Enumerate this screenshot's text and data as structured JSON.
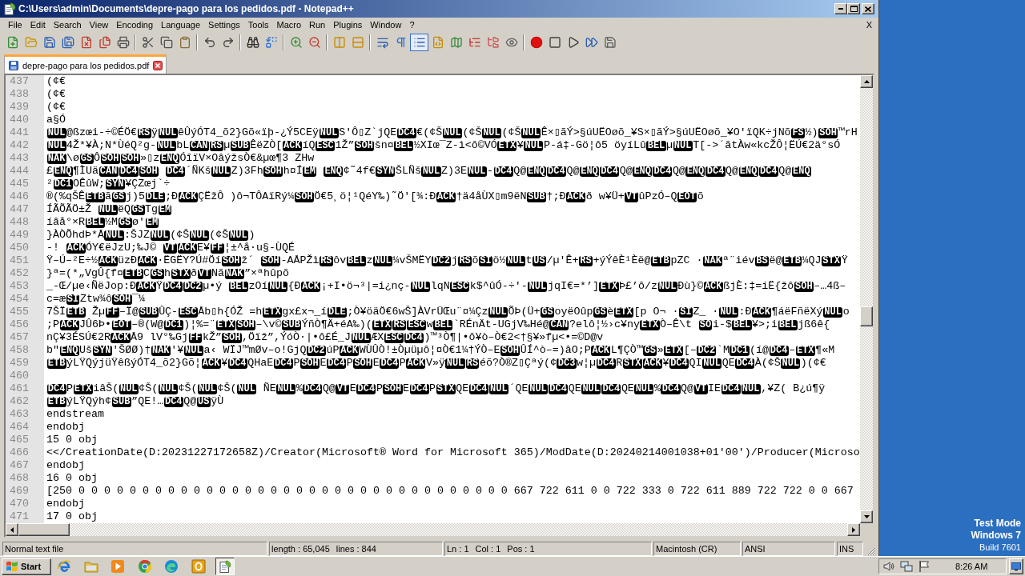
{
  "window": {
    "title": "C:\\Users\\admin\\Documents\\depre-pago para los pedidos.pdf - Notepad++"
  },
  "menu": {
    "items": [
      "File",
      "Edit",
      "Search",
      "View",
      "Encoding",
      "Language",
      "Settings",
      "Tools",
      "Macro",
      "Run",
      "Plugins",
      "Window",
      "?"
    ],
    "close_label": "X"
  },
  "toolbar": {
    "buttons": [
      {
        "pressed": false
      },
      {
        "pressed": false
      },
      {
        "pressed": false
      },
      {
        "pressed": false
      },
      {
        "pressed": false
      },
      {
        "pressed": false
      },
      {
        "pressed": false
      },
      {
        "pressed": false
      },
      {
        "pressed": false
      },
      {
        "pressed": false
      },
      {
        "pressed": false
      },
      {
        "pressed": false
      },
      {
        "pressed": false
      },
      {
        "pressed": false
      },
      {
        "pressed": false
      },
      {
        "pressed": false
      },
      {
        "pressed": false
      },
      {
        "pressed": false
      },
      {
        "pressed": false
      },
      {
        "pressed": false
      },
      {
        "pressed": true
      },
      {
        "pressed": false
      },
      {
        "pressed": false
      },
      {
        "pressed": false
      },
      {
        "pressed": false
      },
      {
        "pressed": false
      },
      {
        "pressed": false
      },
      {
        "pressed": false
      },
      {
        "pressed": false
      },
      {
        "pressed": false
      },
      {
        "pressed": false
      }
    ]
  },
  "tabs": [
    {
      "label": "depre-pago para los pedidos.pdf",
      "selected": true
    }
  ],
  "editor": {
    "lines": [
      {
        "number": "437",
        "segments": [
          {
            "kind": "text",
            "text": "(¢€"
          }
        ]
      },
      {
        "number": "438",
        "segments": [
          {
            "kind": "text",
            "text": "(¢€"
          }
        ]
      },
      {
        "number": "439",
        "segments": [
          {
            "kind": "text",
            "text": "(¢€"
          }
        ]
      },
      {
        "number": "440",
        "segments": [
          {
            "kind": "text",
            "text": "a§Ó"
          }
        ]
      },
      {
        "number": "441",
        "segments": [
          {
            "kind": "ctrl",
            "text": "NUL"
          },
          {
            "kind": "text",
            "text": "@ßzœi-÷©ÉÖ€"
          },
          {
            "kind": "ctrl",
            "text": "RS"
          },
          {
            "kind": "text",
            "text": "ÿ"
          },
          {
            "kind": "ctrl",
            "text": "NUL"
          },
          {
            "kind": "text",
            "text": "êÛýÓT4_õ2}Gõ«ïþ-¿Ý5CEÿ"
          },
          {
            "kind": "ctrl",
            "text": "NUL"
          },
          {
            "kind": "text",
            "text": "S'Ô▯Z`jQE"
          },
          {
            "kind": "ctrl",
            "text": "DC4"
          },
          {
            "kind": "text",
            "text": "€(¢Š"
          },
          {
            "kind": "ctrl",
            "text": "NUL"
          },
          {
            "kind": "text",
            "text": "(¢Š"
          },
          {
            "kind": "ctrl",
            "text": "NUL"
          },
          {
            "kind": "text",
            "text": "(¢Š"
          },
          {
            "kind": "ctrl",
            "text": "NUL"
          },
          {
            "kind": "text",
            "text": "Ê×▯ãÝ>§úUËOøõ_¥S×▯ãÝ>§úUËOøõ_¥O'ïQK÷jNõ"
          },
          {
            "kind": "ctrl",
            "text": "FS"
          },
          {
            "kind": "text",
            "text": "½)"
          },
          {
            "kind": "ctrl",
            "text": "SOH"
          },
          {
            "kind": "text",
            "text": "™rH"
          }
        ]
      },
      {
        "number": "442",
        "segments": [
          {
            "kind": "ctrl",
            "text": "NUL"
          },
          {
            "kind": "text",
            "text": "4Ž*¥À;N*ÙéQ²g-"
          },
          {
            "kind": "ctrl",
            "text": "NUL"
          },
          {
            "kind": "text",
            "text": "bL"
          },
          {
            "kind": "ctrl",
            "text": "CAN"
          },
          {
            "kind": "ctrl",
            "text": "RS"
          },
          {
            "kind": "text",
            "text": "µ"
          },
          {
            "kind": "ctrl",
            "text": "SUB"
          },
          {
            "kind": "text",
            "text": "ÊëZÒ["
          },
          {
            "kind": "ctrl",
            "text": "ACK"
          },
          {
            "kind": "text",
            "text": "íQ"
          },
          {
            "kind": "ctrl",
            "text": "ESC"
          },
          {
            "kind": "text",
            "text": "1Ž”"
          },
          {
            "kind": "ctrl",
            "text": "SOH"
          },
          {
            "kind": "text",
            "text": "šn¤"
          },
          {
            "kind": "ctrl",
            "text": "BEL"
          },
          {
            "kind": "text",
            "text": "½XIœ¯Z-ì<ô©VÓ"
          },
          {
            "kind": "ctrl",
            "text": "ETX"
          },
          {
            "kind": "text",
            "text": "¥"
          },
          {
            "kind": "ctrl",
            "text": "NUL"
          },
          {
            "kind": "text",
            "text": "P-á‡-Gö¦ô5 öyíLû"
          },
          {
            "kind": "ctrl",
            "text": "BEL"
          },
          {
            "kind": "text",
            "text": "µ"
          },
          {
            "kind": "ctrl",
            "text": "NUL"
          },
          {
            "kind": "text",
            "text": "T[->´ãtÀw«kcŽÔ¦ËÚ€2ä°sÓ"
          }
        ]
      },
      {
        "number": "443",
        "segments": [
          {
            "kind": "ctrl",
            "text": "NAK"
          },
          {
            "kind": "text",
            "text": "\\ø"
          },
          {
            "kind": "ctrl",
            "text": "GS"
          },
          {
            "kind": "text",
            "text": "Ô"
          },
          {
            "kind": "ctrl",
            "text": "SOH"
          },
          {
            "kind": "ctrl",
            "text": "SOH"
          },
          {
            "kind": "text",
            "text": "»▯z"
          },
          {
            "kind": "ctrl",
            "text": "ENQ"
          },
          {
            "kind": "text",
            "text": "ÓîïV×OâýžsÒ€&µœ¶3 ZHw"
          }
        ]
      },
      {
        "number": "444",
        "segments": [
          {
            "kind": "text",
            "text": "£"
          },
          {
            "kind": "ctrl",
            "text": "ENQ"
          },
          {
            "kind": "text",
            "text": "¶ÌUä"
          },
          {
            "kind": "ctrl",
            "text": "CAN"
          },
          {
            "kind": "ctrl",
            "text": "DC4"
          },
          {
            "kind": "ctrl",
            "text": "SOH"
          },
          {
            "kind": "space"
          },
          {
            "kind": "ctrl",
            "text": "DC4"
          },
          {
            "kind": "text",
            "text": "´ÑKš"
          },
          {
            "kind": "ctrl",
            "text": "NUL"
          },
          {
            "kind": "text",
            "text": "Z)3Fh"
          },
          {
            "kind": "ctrl",
            "text": "SOH"
          },
          {
            "kind": "text",
            "text": "h¤Í"
          },
          {
            "kind": "ctrl",
            "text": "EM"
          },
          {
            "kind": "space"
          },
          {
            "kind": "ctrl",
            "text": "ENQ"
          },
          {
            "kind": "text",
            "text": "¢˜4f€"
          },
          {
            "kind": "ctrl",
            "text": "SYN"
          },
          {
            "kind": "text",
            "text": "ŠLÑš"
          },
          {
            "kind": "ctrl",
            "text": "NUL"
          },
          {
            "kind": "text",
            "text": "Z)3E"
          },
          {
            "kind": "ctrl",
            "text": "NUL"
          },
          {
            "kind": "text",
            "text": "-"
          },
          {
            "kind": "ctrl",
            "text": "DC4"
          },
          {
            "kind": "text",
            "text": "Q@"
          },
          {
            "kind": "ctrl",
            "text": "ENQ"
          },
          {
            "kind": "ctrl",
            "text": "DC4"
          },
          {
            "kind": "text",
            "text": "Q@"
          },
          {
            "kind": "ctrl",
            "text": "ENQ"
          },
          {
            "kind": "ctrl",
            "text": "DC4"
          },
          {
            "kind": "text",
            "text": "Q@"
          },
          {
            "kind": "ctrl",
            "text": "ENQ"
          },
          {
            "kind": "ctrl",
            "text": "DC4"
          },
          {
            "kind": "text",
            "text": "Q@"
          },
          {
            "kind": "ctrl",
            "text": "ENQ"
          },
          {
            "kind": "ctrl",
            "text": "DC4"
          },
          {
            "kind": "text",
            "text": "Q@"
          },
          {
            "kind": "ctrl",
            "text": "ENQ"
          },
          {
            "kind": "ctrl",
            "text": "DC4"
          },
          {
            "kind": "text",
            "text": "Q@"
          },
          {
            "kind": "ctrl",
            "text": "ENQ"
          }
        ]
      },
      {
        "number": "445",
        "segments": [
          {
            "kind": "text",
            "text": "²"
          },
          {
            "kind": "ctrl",
            "text": "DC1"
          },
          {
            "kind": "text",
            "text": "OÊûW;"
          },
          {
            "kind": "ctrl",
            "text": "SYN"
          },
          {
            "kind": "text",
            "text": "¥ÇZœj`÷"
          }
        ]
      },
      {
        "number": "446",
        "segments": [
          {
            "kind": "text",
            "text": "®(%qŠÊ"
          },
          {
            "kind": "ctrl",
            "text": "ETB"
          },
          {
            "kind": "text",
            "text": "ã"
          },
          {
            "kind": "ctrl",
            "text": "GS"
          },
          {
            "kind": "text",
            "text": "j)5"
          },
          {
            "kind": "ctrl",
            "text": "DLE"
          },
          {
            "kind": "text",
            "text": ";Ð"
          },
          {
            "kind": "ctrl",
            "text": "ACK"
          },
          {
            "kind": "text",
            "text": "ÇËžÔ )ô¬TÔAïRý¼"
          },
          {
            "kind": "ctrl",
            "text": "SOH"
          },
          {
            "kind": "text",
            "text": "Ö€5¸ö¦¹QéY‰)˜Ö'[¾:Ð"
          },
          {
            "kind": "ctrl",
            "text": "ACK"
          },
          {
            "kind": "text",
            "text": "†ä4åÙX▯m9ëN"
          },
          {
            "kind": "ctrl",
            "text": "SUB"
          },
          {
            "kind": "text",
            "text": "†;Ð"
          },
          {
            "kind": "ctrl",
            "text": "ACK"
          },
          {
            "kind": "text",
            "text": "ð w¥Ü+"
          },
          {
            "kind": "ctrl",
            "text": "VT"
          },
          {
            "kind": "text",
            "text": "ûPzÓ–Q"
          },
          {
            "kind": "ctrl",
            "text": "EOT"
          },
          {
            "kind": "text",
            "text": "õ"
          }
        ]
      },
      {
        "number": "447",
        "segments": [
          {
            "kind": "text",
            "text": "ÍÃÕÃÖ±Ž "
          },
          {
            "kind": "ctrl",
            "text": "NUL"
          },
          {
            "kind": "text",
            "text": "ëQ"
          },
          {
            "kind": "ctrl",
            "text": "GS"
          },
          {
            "kind": "text",
            "text": "Tg"
          },
          {
            "kind": "ctrl",
            "text": "EM"
          }
        ]
      },
      {
        "number": "448",
        "segments": [
          {
            "kind": "text",
            "text": "íâå°×R"
          },
          {
            "kind": "ctrl",
            "text": "BEL"
          },
          {
            "kind": "text",
            "text": "½M"
          },
          {
            "kind": "ctrl",
            "text": "GS"
          },
          {
            "kind": "text",
            "text": "ø'"
          },
          {
            "kind": "ctrl",
            "text": "EM"
          }
        ]
      },
      {
        "number": "449",
        "segments": [
          {
            "kind": "text",
            "text": "}ÀÒÕhdÞ*Å"
          },
          {
            "kind": "ctrl",
            "text": "NUL"
          },
          {
            "kind": "text",
            "text": ":ŠJZ"
          },
          {
            "kind": "ctrl",
            "text": "NUL"
          },
          {
            "kind": "text",
            "text": "(¢Š"
          },
          {
            "kind": "ctrl",
            "text": "NUL"
          },
          {
            "kind": "text",
            "text": "(¢Š"
          },
          {
            "kind": "ctrl",
            "text": "NUL"
          },
          {
            "kind": "text",
            "text": ")"
          }
        ]
      },
      {
        "number": "450",
        "segments": [
          {
            "kind": "text",
            "text": "-! "
          },
          {
            "kind": "ctrl",
            "text": "ACK"
          },
          {
            "kind": "text",
            "text": "ÓY€ëJzU;‰J© "
          },
          {
            "kind": "ctrl",
            "text": "VT"
          },
          {
            "kind": "ctrl",
            "text": "ACK"
          },
          {
            "kind": "text",
            "text": "E¥"
          },
          {
            "kind": "ctrl",
            "text": "FF"
          },
          {
            "kind": "text",
            "text": "¦±^å·u§-ÙQÉ"
          }
        ]
      },
      {
        "number": "451",
        "segments": [
          {
            "kind": "text",
            "text": "Ÿ–Ú–²E÷½"
          },
          {
            "kind": "ctrl",
            "text": "ACK"
          },
          {
            "kind": "text",
            "text": "üzÐ"
          },
          {
            "kind": "ctrl",
            "text": "ACK"
          },
          {
            "kind": "text",
            "text": "·ËGËY?Ú#Öí"
          },
          {
            "kind": "ctrl",
            "text": "SOH"
          },
          {
            "kind": "text",
            "text": "ž´ "
          },
          {
            "kind": "ctrl",
            "text": "SOH"
          },
          {
            "kind": "text",
            "text": "-AÅPŽì"
          },
          {
            "kind": "ctrl",
            "text": "RS"
          },
          {
            "kind": "text",
            "text": "ôv"
          },
          {
            "kind": "ctrl",
            "text": "BEL"
          },
          {
            "kind": "text",
            "text": "z"
          },
          {
            "kind": "ctrl",
            "text": "NUL"
          },
          {
            "kind": "text",
            "text": "¼vŠMËY"
          },
          {
            "kind": "ctrl",
            "text": "DC2"
          },
          {
            "kind": "text",
            "text": "j"
          },
          {
            "kind": "ctrl",
            "text": "RS"
          },
          {
            "kind": "text",
            "text": "õ"
          },
          {
            "kind": "ctrl",
            "text": "SI"
          },
          {
            "kind": "text",
            "text": "ö½"
          },
          {
            "kind": "ctrl",
            "text": "NUL"
          },
          {
            "kind": "text",
            "text": "t"
          },
          {
            "kind": "ctrl",
            "text": "US"
          },
          {
            "kind": "text",
            "text": "/µ'Ê+"
          },
          {
            "kind": "ctrl",
            "text": "RS"
          },
          {
            "kind": "text",
            "text": "+ýÝêÈ¹Èë@"
          },
          {
            "kind": "ctrl",
            "text": "ETB"
          },
          {
            "kind": "text",
            "text": "pZC ·"
          },
          {
            "kind": "ctrl",
            "text": "NAK"
          },
          {
            "kind": "text",
            "text": "ª¨iév"
          },
          {
            "kind": "ctrl",
            "text": "BS"
          },
          {
            "kind": "text",
            "text": "ë@"
          },
          {
            "kind": "ctrl",
            "text": "ETB"
          },
          {
            "kind": "text",
            "text": "¼QJ"
          },
          {
            "kind": "ctrl",
            "text": "STX"
          },
          {
            "kind": "text",
            "text": "Ÿ"
          }
        ]
      },
      {
        "number": "452",
        "segments": [
          {
            "kind": "text",
            "text": "}ª=(*„VgÛ{f¤"
          },
          {
            "kind": "ctrl",
            "text": "ETB"
          },
          {
            "kind": "text",
            "text": "C"
          },
          {
            "kind": "ctrl",
            "text": "GS"
          },
          {
            "kind": "text",
            "text": "h"
          },
          {
            "kind": "ctrl",
            "text": "STX"
          },
          {
            "kind": "text",
            "text": "ð"
          },
          {
            "kind": "ctrl",
            "text": "VT"
          },
          {
            "kind": "text",
            "text": "Nã"
          },
          {
            "kind": "ctrl",
            "text": "NAK"
          },
          {
            "kind": "text",
            "text": "”×ªhûpõ"
          }
        ]
      },
      {
        "number": "453",
        "segments": [
          {
            "kind": "text",
            "text": "_-Œ/µe‹ÑëJop:Ð"
          },
          {
            "kind": "ctrl",
            "text": "ACK"
          },
          {
            "kind": "text",
            "text": "Ÿ"
          },
          {
            "kind": "ctrl",
            "text": "DC4"
          },
          {
            "kind": "ctrl",
            "text": "DC2"
          },
          {
            "kind": "text",
            "text": "µ•ý "
          },
          {
            "kind": "ctrl",
            "text": "BEL"
          },
          {
            "kind": "text",
            "text": "zOí"
          },
          {
            "kind": "ctrl",
            "text": "NUL"
          },
          {
            "kind": "text",
            "text": "{Ð"
          },
          {
            "kind": "ctrl",
            "text": "ACK"
          },
          {
            "kind": "text",
            "text": "¡+I•ö¬³|=i¿nç-"
          },
          {
            "kind": "ctrl",
            "text": "NUL"
          },
          {
            "kind": "text",
            "text": "lqN"
          },
          {
            "kind": "ctrl",
            "text": "ESC"
          },
          {
            "kind": "text",
            "text": "k$^ûÓ-÷'-"
          },
          {
            "kind": "ctrl",
            "text": "NUL"
          },
          {
            "kind": "text",
            "text": "jqI€=*’]"
          },
          {
            "kind": "ctrl",
            "text": "ETX"
          },
          {
            "kind": "text",
            "text": "Þ£’ô/z"
          },
          {
            "kind": "ctrl",
            "text": "NUL"
          },
          {
            "kind": "text",
            "text": "Ðù}©"
          },
          {
            "kind": "ctrl",
            "text": "ACK"
          },
          {
            "kind": "text",
            "text": "ßjÈ:‡=iË{žô"
          },
          {
            "kind": "ctrl",
            "text": "SOH"
          },
          {
            "kind": "text",
            "text": "–…4ß–"
          }
        ]
      },
      {
        "number": "454",
        "segments": [
          {
            "kind": "text",
            "text": "c=æ"
          },
          {
            "kind": "ctrl",
            "text": "SI"
          },
          {
            "kind": "text",
            "text": "Ztw¾ô"
          },
          {
            "kind": "ctrl",
            "text": "SOH"
          },
          {
            "kind": "text",
            "text": "¯¼"
          }
        ]
      },
      {
        "number": "455",
        "segments": [
          {
            "kind": "text",
            "text": "7ŠÏ"
          },
          {
            "kind": "ctrl",
            "text": "ETB"
          },
          {
            "kind": "text",
            "text": " Žµ"
          },
          {
            "kind": "ctrl",
            "text": "FF"
          },
          {
            "kind": "text",
            "text": "–Ï@"
          },
          {
            "kind": "ctrl",
            "text": "SUB"
          },
          {
            "kind": "text",
            "text": "ÛÇ-"
          },
          {
            "kind": "ctrl",
            "text": "ESC"
          },
          {
            "kind": "text",
            "text": "Åb▯h{ÓŽ =h"
          },
          {
            "kind": "ctrl",
            "text": "ETX"
          },
          {
            "kind": "text",
            "text": "gx£x¬_í"
          },
          {
            "kind": "ctrl",
            "text": "DLE"
          },
          {
            "kind": "text",
            "text": ";Ò¥öäÖ€6wŠ]ÀVrÜŒu¨¤¼Çz"
          },
          {
            "kind": "ctrl",
            "text": "NUL"
          },
          {
            "kind": "text",
            "text": "ÕÞ(Ü+"
          },
          {
            "kind": "ctrl",
            "text": "GS"
          },
          {
            "kind": "text",
            "text": "oyëOûp"
          },
          {
            "kind": "ctrl",
            "text": "GS"
          },
          {
            "kind": "text",
            "text": "è"
          },
          {
            "kind": "ctrl",
            "text": "ETX"
          },
          {
            "kind": "text",
            "text": "[p O¬ ·"
          },
          {
            "kind": "ctrl",
            "text": "SI"
          },
          {
            "kind": "text",
            "text": "Z_ ·"
          },
          {
            "kind": "ctrl",
            "text": "NUL"
          },
          {
            "kind": "text",
            "text": ":Ð"
          },
          {
            "kind": "ctrl",
            "text": "ACK"
          },
          {
            "kind": "text",
            "text": "¶áëFñëXý"
          },
          {
            "kind": "ctrl",
            "text": "NUL"
          },
          {
            "kind": "text",
            "text": "o"
          }
        ]
      },
      {
        "number": "456",
        "segments": [
          {
            "kind": "text",
            "text": ";P"
          },
          {
            "kind": "ctrl",
            "text": "ACK"
          },
          {
            "kind": "text",
            "text": "JÛ6Þ•"
          },
          {
            "kind": "ctrl",
            "text": "EOT"
          },
          {
            "kind": "text",
            "text": "–®(W@"
          },
          {
            "kind": "ctrl",
            "text": "DC1"
          },
          {
            "kind": "text",
            "text": ")¦%=¨"
          },
          {
            "kind": "ctrl",
            "text": "ETX"
          },
          {
            "kind": "ctrl",
            "text": "SOH"
          },
          {
            "kind": "text",
            "text": "–\\v©"
          },
          {
            "kind": "ctrl",
            "text": "SUB"
          },
          {
            "kind": "text",
            "text": "ÝñÒ¶Ä+éA‰)("
          },
          {
            "kind": "ctrl",
            "text": "ETX"
          },
          {
            "kind": "ctrl",
            "text": "RS"
          },
          {
            "kind": "ctrl",
            "text": "ESC"
          },
          {
            "kind": "text",
            "text": "w"
          },
          {
            "kind": "ctrl",
            "text": "BEL"
          },
          {
            "kind": "text",
            "text": "`RÉnÄt-UGjV‰Hé@"
          },
          {
            "kind": "ctrl",
            "text": "CAN"
          },
          {
            "kind": "text",
            "text": "?elô¦½›c¥ny"
          },
          {
            "kind": "ctrl",
            "text": "ETX"
          },
          {
            "kind": "text",
            "text": "Ò–Ê\\t "
          },
          {
            "kind": "ctrl",
            "text": "SO"
          },
          {
            "kind": "text",
            "text": "i-$"
          },
          {
            "kind": "ctrl",
            "text": "BEL"
          },
          {
            "kind": "text",
            "text": "¥>;i"
          },
          {
            "kind": "ctrl",
            "text": "BEL"
          },
          {
            "kind": "text",
            "text": "jß6ê{"
          }
        ]
      },
      {
        "number": "457",
        "segments": [
          {
            "kind": "text",
            "text": "nÇ¥3ÉSÚ€2R"
          },
          {
            "kind": "ctrl",
            "text": "ACK"
          },
          {
            "kind": "text",
            "text": "Å9 lV°‰Gj"
          },
          {
            "kind": "ctrl",
            "text": "FF"
          },
          {
            "kind": "text",
            "text": "kŽ”"
          },
          {
            "kind": "ctrl",
            "text": "SOH"
          },
          {
            "kind": "text",
            "text": ",Öïž”,ÝóÒ·|•ô£É_J"
          },
          {
            "kind": "ctrl",
            "text": "NUL"
          },
          {
            "kind": "text",
            "text": "ÆX"
          },
          {
            "kind": "ctrl",
            "text": "ESC"
          },
          {
            "kind": "ctrl",
            "text": "DC4"
          },
          {
            "kind": "text",
            "text": ")™³Ò¶|•ô¥ò–Ò€2<†§¥»fµ<•=©D@v"
          }
        ]
      },
      {
        "number": "458",
        "segments": [
          {
            "kind": "text",
            "text": "b\""
          },
          {
            "kind": "ctrl",
            "text": "ENQ"
          },
          {
            "kind": "text",
            "text": "Uš"
          },
          {
            "kind": "ctrl",
            "text": "SYN"
          },
          {
            "kind": "text",
            "text": "'ŠØØ)†"
          },
          {
            "kind": "ctrl",
            "text": "NAK"
          },
          {
            "kind": "text",
            "text": "'¥"
          },
          {
            "kind": "ctrl",
            "text": "NUL"
          },
          {
            "kind": "text",
            "text": "a‹ WÏJ™mØv–o!GjQ"
          },
          {
            "kind": "ctrl",
            "text": "DC2"
          },
          {
            "kind": "text",
            "text": "úP"
          },
          {
            "kind": "ctrl",
            "text": "ACK"
          },
          {
            "kind": "text",
            "text": "WÙÛÒ!±Òµüµô¦¤Ò€1¼†ÝÒ–E"
          },
          {
            "kind": "ctrl",
            "text": "SOH"
          },
          {
            "kind": "text",
            "text": "ÛÍ^ò–=)âO;P"
          },
          {
            "kind": "ctrl",
            "text": "ACK"
          },
          {
            "kind": "text",
            "text": "L¶ÇÒ™"
          },
          {
            "kind": "ctrl",
            "text": "GS"
          },
          {
            "kind": "text",
            "text": "»"
          },
          {
            "kind": "ctrl",
            "text": "ETX"
          },
          {
            "kind": "text",
            "text": "[–"
          },
          {
            "kind": "ctrl",
            "text": "DC2"
          },
          {
            "kind": "text",
            "text": "`M"
          },
          {
            "kind": "ctrl",
            "text": "DC1"
          },
          {
            "kind": "text",
            "text": "(í@"
          },
          {
            "kind": "ctrl",
            "text": "DC4"
          },
          {
            "kind": "text",
            "text": "–"
          },
          {
            "kind": "ctrl",
            "text": "ETX"
          },
          {
            "kind": "text",
            "text": "¶«M"
          }
        ]
      },
      {
        "number": "459",
        "segments": [
          {
            "kind": "ctrl",
            "text": "ETB"
          },
          {
            "kind": "text",
            "text": "ýLŸQýjüŸêßýÓT4_õ2}Gõ¦"
          },
          {
            "kind": "ctrl",
            "text": "ACK"
          },
          {
            "kind": "text",
            "text": "¥"
          },
          {
            "kind": "ctrl",
            "text": "DC4"
          },
          {
            "kind": "text",
            "text": "QHaE"
          },
          {
            "kind": "ctrl",
            "text": "DC4"
          },
          {
            "kind": "text",
            "text": "P"
          },
          {
            "kind": "ctrl",
            "text": "SOH"
          },
          {
            "kind": "text",
            "text": "E"
          },
          {
            "kind": "ctrl",
            "text": "DC4"
          },
          {
            "kind": "text",
            "text": "P"
          },
          {
            "kind": "ctrl",
            "text": "SOH"
          },
          {
            "kind": "text",
            "text": "E"
          },
          {
            "kind": "ctrl",
            "text": "DC4"
          },
          {
            "kind": "text",
            "text": "P"
          },
          {
            "kind": "ctrl",
            "text": "ACK"
          },
          {
            "kind": "text",
            "text": "V»ÿ"
          },
          {
            "kind": "ctrl",
            "text": "NUL"
          },
          {
            "kind": "ctrl",
            "text": "RS"
          },
          {
            "kind": "text",
            "text": "éõ?Ò®Z▯Çªý(¢"
          },
          {
            "kind": "ctrl",
            "text": "DC3"
          },
          {
            "kind": "text",
            "text": "w¦µ"
          },
          {
            "kind": "ctrl",
            "text": "DC4"
          },
          {
            "kind": "text",
            "text": "R"
          },
          {
            "kind": "ctrl",
            "text": "STX"
          },
          {
            "kind": "ctrl",
            "text": "ACK"
          },
          {
            "kind": "text",
            "text": "¥"
          },
          {
            "kind": "ctrl",
            "text": "DC4"
          },
          {
            "kind": "text",
            "text": "QI"
          },
          {
            "kind": "ctrl",
            "text": "NUL"
          },
          {
            "kind": "text",
            "text": "QE"
          },
          {
            "kind": "ctrl",
            "text": "DC4"
          },
          {
            "kind": "text",
            "text": "À(¢Š"
          },
          {
            "kind": "ctrl",
            "text": "NUL"
          },
          {
            "kind": "text",
            "text": ")(¢€"
          }
        ]
      },
      {
        "number": "460"
      },
      {
        "number": "461",
        "segments": [
          {
            "kind": "ctrl",
            "text": "DC4"
          },
          {
            "kind": "text",
            "text": "P"
          },
          {
            "kind": "ctrl",
            "text": "ETX"
          },
          {
            "kind": "text",
            "text": "iâŠ("
          },
          {
            "kind": "ctrl",
            "text": "NUL"
          },
          {
            "kind": "text",
            "text": "¢Š("
          },
          {
            "kind": "ctrl",
            "text": "NUL"
          },
          {
            "kind": "text",
            "text": "¢Š("
          },
          {
            "kind": "ctrl",
            "text": "NUL"
          },
          {
            "kind": "text",
            "text": "¢Š("
          },
          {
            "kind": "ctrl",
            "text": "NUL"
          },
          {
            "kind": "text",
            "text": " ÑE"
          },
          {
            "kind": "ctrl",
            "text": "NUL"
          },
          {
            "kind": "text",
            "text": "%"
          },
          {
            "kind": "ctrl",
            "text": "DC4"
          },
          {
            "kind": "text",
            "text": "Q@"
          },
          {
            "kind": "ctrl",
            "text": "VT"
          },
          {
            "kind": "text",
            "text": "E"
          },
          {
            "kind": "ctrl",
            "text": "DC4"
          },
          {
            "kind": "text",
            "text": "P"
          },
          {
            "kind": "ctrl",
            "text": "SOH"
          },
          {
            "kind": "text",
            "text": "E"
          },
          {
            "kind": "ctrl",
            "text": "DC4"
          },
          {
            "kind": "text",
            "text": "P"
          },
          {
            "kind": "ctrl",
            "text": "STX"
          },
          {
            "kind": "text",
            "text": "QE"
          },
          {
            "kind": "ctrl",
            "text": "DC4"
          },
          {
            "kind": "ctrl",
            "text": "NUL"
          },
          {
            "kind": "text",
            "text": "´QE"
          },
          {
            "kind": "ctrl",
            "text": "NUL"
          },
          {
            "kind": "ctrl",
            "text": "DC4"
          },
          {
            "kind": "text",
            "text": "QE"
          },
          {
            "kind": "ctrl",
            "text": "NUL"
          },
          {
            "kind": "ctrl",
            "text": "DC4"
          },
          {
            "kind": "text",
            "text": "QE"
          },
          {
            "kind": "ctrl",
            "text": "NUL"
          },
          {
            "kind": "text",
            "text": "%"
          },
          {
            "kind": "ctrl",
            "text": "DC4"
          },
          {
            "kind": "text",
            "text": "Q@"
          },
          {
            "kind": "ctrl",
            "text": "VT"
          },
          {
            "kind": "text",
            "text": "IE"
          },
          {
            "kind": "ctrl",
            "text": "DC4"
          },
          {
            "kind": "ctrl",
            "text": "NUL"
          },
          {
            "kind": "text",
            "text": ",¥Z( B¿ú¶ÿ"
          }
        ]
      },
      {
        "number": "462",
        "segments": [
          {
            "kind": "ctrl",
            "text": "ETB"
          },
          {
            "kind": "text",
            "text": "ýLŸQýh¢"
          },
          {
            "kind": "ctrl",
            "text": "SUB"
          },
          {
            "kind": "text",
            "text": "”QE!…"
          },
          {
            "kind": "ctrl",
            "text": "DC4"
          },
          {
            "kind": "text",
            "text": "Q@"
          },
          {
            "kind": "ctrl",
            "text": "US"
          },
          {
            "kind": "text",
            "text": "ÿÙ"
          }
        ]
      },
      {
        "number": "463",
        "segments": [
          {
            "kind": "text",
            "text": "endstream"
          }
        ]
      },
      {
        "number": "464",
        "segments": [
          {
            "kind": "text",
            "text": "endobj"
          }
        ]
      },
      {
        "number": "465",
        "segments": [
          {
            "kind": "text",
            "text": "15 0 obj"
          }
        ]
      },
      {
        "number": "466",
        "segments": [
          {
            "kind": "text",
            "text": "<</CreationDate(D:20231227172658Z)/Creator(Microsoft® Word for Microsoft 365)/ModDate(D:20240214001038+01'00')/Producer(Microso"
          }
        ]
      },
      {
        "number": "467",
        "segments": [
          {
            "kind": "text",
            "text": "endobj"
          }
        ]
      },
      {
        "number": "468",
        "segments": [
          {
            "kind": "text",
            "text": "16 0 obj"
          }
        ]
      },
      {
        "number": "469",
        "segments": [
          {
            "kind": "text",
            "text": "[250 0 0 0 0 0 0 0 0 0 0 0 0 0 0 0 0 0 0 0 0 0 0 0 0 0 0 0 0 0 0 0 0 0 0 667 722 611 0 0 722 333 0 722 611 889 722 722 0 0 667"
          }
        ]
      },
      {
        "number": "470",
        "segments": [
          {
            "kind": "text",
            "text": "endobj"
          }
        ]
      },
      {
        "number": "471",
        "segments": [
          {
            "kind": "text",
            "text": "17 0 obj"
          }
        ]
      }
    ]
  },
  "status_bar": {
    "panels": [
      [
        "Normal text file"
      ],
      [
        "length : 65,045",
        "lines : 844"
      ],
      [
        "Ln : 1",
        "Col : 1",
        "Pos : 1"
      ],
      [
        "Macintosh (CR)"
      ],
      [
        "ANSI"
      ],
      [
        "INS"
      ]
    ]
  },
  "taskbar": {
    "start_label": "Start",
    "apps": [
      {
        "selected": false
      },
      {
        "selected": false
      },
      {
        "selected": false
      },
      {
        "selected": false
      },
      {
        "selected": false
      },
      {
        "selected": false
      },
      {
        "selected": true
      }
    ],
    "clock": "8:26 AM"
  },
  "desktop_notice": [
    "Test Mode",
    "Windows 7",
    "Build 7601"
  ]
}
